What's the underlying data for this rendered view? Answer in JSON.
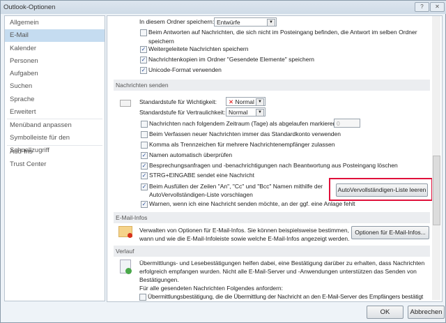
{
  "window": {
    "title": "Outlook-Optionen",
    "help": "?",
    "close": "✕"
  },
  "sidebar": {
    "items": [
      {
        "label": "Allgemein"
      },
      {
        "label": "E-Mail"
      },
      {
        "label": "Kalender"
      },
      {
        "label": "Personen"
      },
      {
        "label": "Aufgaben"
      },
      {
        "label": "Suchen"
      },
      {
        "label": "Sprache"
      },
      {
        "label": "Erweitert"
      },
      {
        "label": "Menüband anpassen"
      },
      {
        "label": "Symbolleiste für den Schnellzugriff"
      },
      {
        "label": "Add-Ins"
      },
      {
        "label": "Trust Center"
      }
    ]
  },
  "save": {
    "folder_label": "In diesem Ordner speichern:",
    "folder_value": "Entwürfe",
    "options": [
      {
        "label": "Beim Antworten auf Nachrichten, die sich nicht im Posteingang befinden, die Antwort im selben Ordner",
        "label2": "speichern",
        "checked": false
      },
      {
        "label": "Weitergeleitete Nachrichten speichern",
        "checked": true
      },
      {
        "label": "Nachrichtenkopien im Ordner \"Gesendete Elemente\" speichern",
        "checked": true
      },
      {
        "label": "Unicode-Format verwenden",
        "checked": true
      }
    ]
  },
  "send": {
    "header": "Nachrichten senden",
    "importance_label": "Standardstufe für Wichtigkeit:",
    "importance_value": "Normal",
    "sensitivity_label": "Standardstufe für Vertraulichkeit:",
    "sensitivity_value": "Normal",
    "expire_label": "Nachrichten nach folgendem Zeitraum (Tage) als abgelaufen markieren:",
    "expire_value": "0",
    "options": [
      {
        "label": "Beim Verfassen neuer Nachrichten immer das Standardkonto verwenden",
        "checked": false
      },
      {
        "label": "Komma als Trennzeichen für mehrere Nachrichtenempfänger zulassen",
        "checked": false
      },
      {
        "label": "Namen automatisch überprüfen",
        "checked": true
      },
      {
        "label": "Besprechungsanfragen und -benachrichtigungen nach Beantwortung aus Posteingang löschen",
        "checked": true
      },
      {
        "label": "STRG+EINGABE sendet eine Nachricht",
        "checked": true
      }
    ],
    "autocomplete_label": "Beim Ausfüllen der Zeilen \"An\", \"Cc\" und \"Bcc\" Namen mithilfe der",
    "autocomplete_label2": "AutoVervollständigen-Liste vorschlagen",
    "autocomplete_button": "AutoVervollständigen-Liste leeren",
    "warn_label": "Warnen, wenn ich eine Nachricht senden möchte, an der ggf. eine Anlage fehlt"
  },
  "mailtips": {
    "header": "E-Mail-Infos",
    "text": "Verwalten von Optionen für E-Mail-Infos. Sie können beispielsweise bestimmen,",
    "text2": "wann und wie die E-Mail-Infoleiste sowie welche E-Mail-Infos angezeigt werden.",
    "button": "Optionen für E-Mail-Infos..."
  },
  "tracking": {
    "header": "Verlauf",
    "text": "Übermittlungs- und Lesebestätigungen helfen dabei, eine Bestätigung darüber zu erhalten, dass Nachrichten",
    "text2": "erfolgreich empfangen wurden. Nicht alle E-Mail-Server und -Anwendungen unterstützen das Senden von",
    "text3": "Bestätigungen.",
    "request_label": "Für alle gesendeten Nachrichten Folgendes anfordern:",
    "delivery_label": "Übermittlungsbestätigung, die die Übermittlung der Nachricht an den E-Mail-Server des Empfängers bestätigt"
  },
  "footer": {
    "ok": "OK",
    "cancel": "Abbrechen"
  },
  "colors": {
    "highlight": "#e0103a",
    "selected": "#c5dcf0"
  }
}
